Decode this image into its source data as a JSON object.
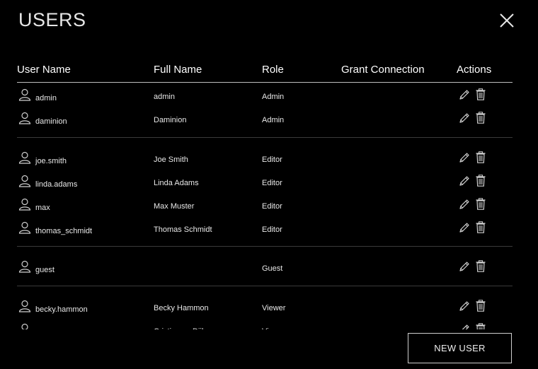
{
  "dialog": {
    "title": "USERS"
  },
  "table": {
    "headers": {
      "user_name": "User Name",
      "full_name": "Full Name",
      "role": "Role",
      "grant_connection": "Grant Connection",
      "actions": "Actions"
    },
    "rows": [
      {
        "user_name": "admin",
        "full_name": "admin",
        "role": "Admin"
      },
      {
        "user_name": "daminion",
        "full_name": "Daminion",
        "role": "Admin"
      },
      {
        "user_name": "joe.smith",
        "full_name": "Joe Smith",
        "role": "Editor"
      },
      {
        "user_name": "linda.adams",
        "full_name": "Linda Adams",
        "role": "Editor"
      },
      {
        "user_name": "max",
        "full_name": "Max Muster",
        "role": "Editor"
      },
      {
        "user_name": "thomas_schmidt",
        "full_name": "Thomas Schmidt",
        "role": "Editor"
      },
      {
        "user_name": "guest",
        "full_name": "",
        "role": "Guest"
      },
      {
        "user_name": "becky.hammon",
        "full_name": "Becky Hammon",
        "role": "Viewer"
      },
      {
        "user_name": "cristie.vandijk",
        "full_name": "Cristie van Dijk",
        "role": "Viewer"
      }
    ]
  },
  "buttons": {
    "new_user": "NEW USER"
  },
  "icons": {
    "user": "user-icon",
    "edit": "pencil-icon",
    "delete": "trash-icon",
    "close": "close-icon"
  }
}
